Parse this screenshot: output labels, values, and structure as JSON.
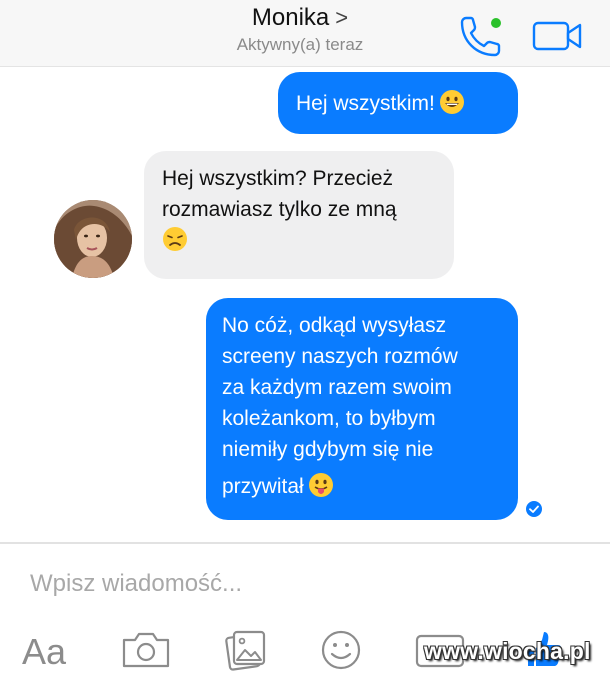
{
  "header": {
    "contact_name": "Monika",
    "chevron": ">",
    "status": "Aktywny(a) teraz",
    "call_icon": "phone-icon",
    "video_icon": "video-camera-icon",
    "online_color": "#2bc12b",
    "accent": "#0a7cff"
  },
  "messages": [
    {
      "side": "outgoing",
      "text": "Hej wszystkim!",
      "emoji": "grinning-face-emoji"
    },
    {
      "side": "incoming",
      "lines": [
        "Hej wszystkim? Przecież",
        "rozmawiasz tylko ze mną"
      ],
      "emoji": "disappointed-face-emoji"
    },
    {
      "side": "outgoing",
      "lines": [
        "No cóż, odkąd wysyłasz",
        "screeny naszych rozmów",
        "za każdym razem swoim",
        "koleżankom, to byłbym",
        "niemiły gdybym się nie",
        "przywitał"
      ],
      "emoji": "face-with-tongue-emoji"
    }
  ],
  "composer": {
    "placeholder": "Wpisz wiadomość...",
    "tools": {
      "text": "Aa",
      "camera_icon": "camera-icon",
      "gallery_icon": "gallery-icon",
      "emoji_icon": "smiley-icon",
      "gif_icon": "gif-icon",
      "like_icon": "thumbs-up-icon"
    }
  },
  "watermark": "www.wiocha.pl",
  "colors": {
    "outgoing_bubble": "#0a7cff",
    "incoming_bubble": "#efeff0",
    "icon": "#8c8c8c"
  }
}
